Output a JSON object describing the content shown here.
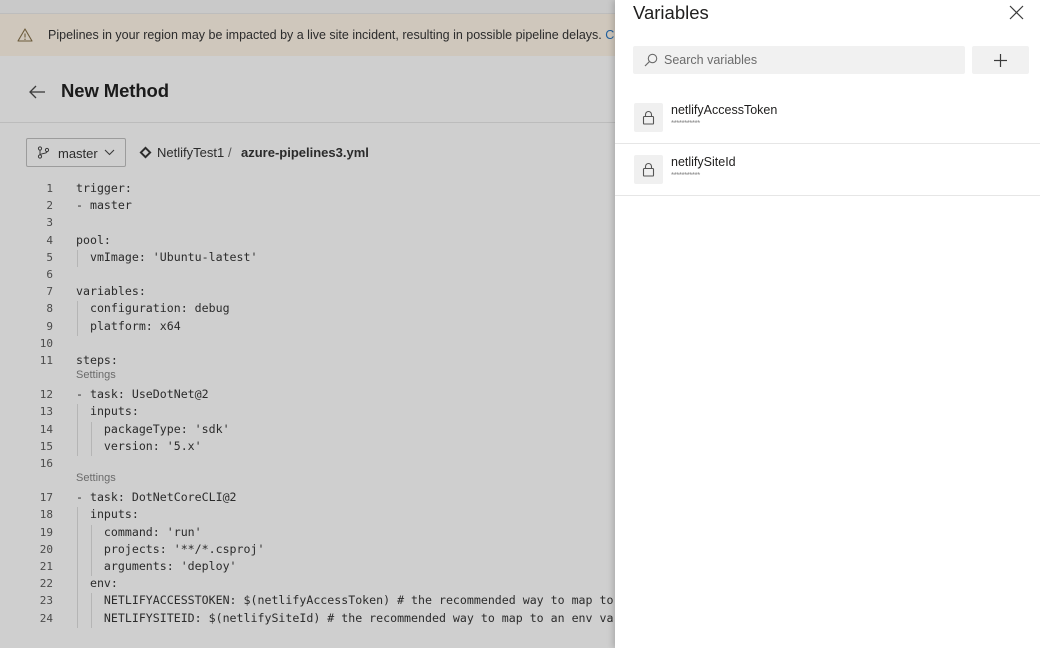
{
  "banner": {
    "message": "Pipelines in your region may be impacted by a live site incident, resulting in possible pipeline delays.",
    "link_fragment": "C"
  },
  "header": {
    "title": "New Method"
  },
  "toolbar": {
    "branch": "master",
    "repository": "NetlifyTest1",
    "separator": "/",
    "file": "azure-pipelines3.yml"
  },
  "editor": {
    "settings_label": "Settings",
    "lines": [
      {
        "n": "1",
        "text": "trigger:"
      },
      {
        "n": "2",
        "text": "- master"
      },
      {
        "n": "3",
        "text": ""
      },
      {
        "n": "4",
        "text": "pool:"
      },
      {
        "n": "5",
        "text": "  vmImage: 'Ubuntu-latest'"
      },
      {
        "n": "6",
        "text": ""
      },
      {
        "n": "7",
        "text": "variables:"
      },
      {
        "n": "8",
        "text": "  configuration: debug"
      },
      {
        "n": "9",
        "text": "  platform: x64"
      },
      {
        "n": "10",
        "text": ""
      },
      {
        "n": "11",
        "text": "steps:"
      },
      {
        "n": "12",
        "text": "- task: UseDotNet@2"
      },
      {
        "n": "13",
        "text": "  inputs:"
      },
      {
        "n": "14",
        "text": "    packageType: 'sdk'"
      },
      {
        "n": "15",
        "text": "    version: '5.x'"
      },
      {
        "n": "16",
        "text": ""
      },
      {
        "n": "17",
        "text": "- task: DotNetCoreCLI@2"
      },
      {
        "n": "18",
        "text": "  inputs:"
      },
      {
        "n": "19",
        "text": "    command: 'run'"
      },
      {
        "n": "20",
        "text": "    projects: '**/*.csproj'"
      },
      {
        "n": "21",
        "text": "    arguments: 'deploy'"
      },
      {
        "n": "22",
        "text": "  env:"
      },
      {
        "n": "23",
        "text": "    NETLIFYACCESSTOKEN: $(netlifyAccessToken) # the recommended way to map to"
      },
      {
        "n": "24",
        "text": "    NETLIFYSITEID: $(netlifySiteId) # the recommended way to map to an env var"
      }
    ]
  },
  "variables_panel": {
    "title": "Variables",
    "search_placeholder": "Search variables",
    "items": [
      {
        "name": "netlifyAccessToken",
        "value": "***********"
      },
      {
        "name": "netlifySiteId",
        "value": "***********"
      }
    ]
  },
  "colors": {
    "panel_bg": "#ffffff",
    "overlay_bg": "#cfcfcf",
    "banner_bg": "#cfc7bc",
    "link": "#1f5f9e"
  }
}
